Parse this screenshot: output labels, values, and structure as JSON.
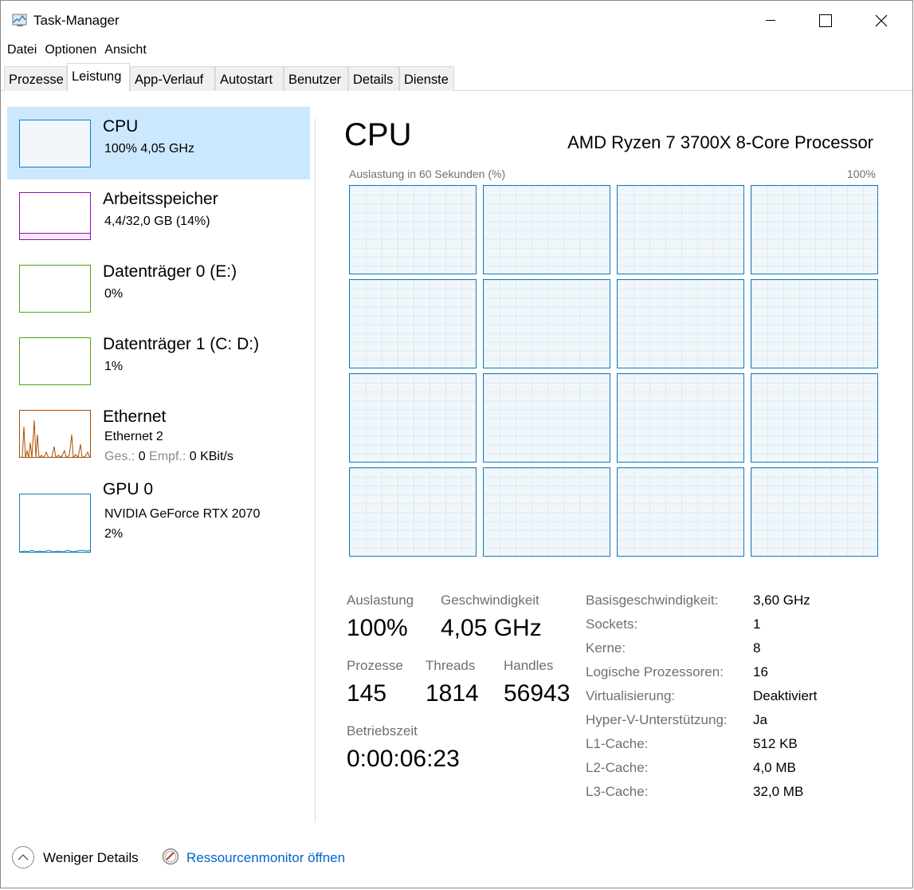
{
  "window": {
    "title": "Task-Manager"
  },
  "menu": {
    "items": [
      "Datei",
      "Optionen",
      "Ansicht"
    ]
  },
  "tabs": [
    "Prozesse",
    "Leistung",
    "App-Verlauf",
    "Autostart",
    "Benutzer",
    "Details",
    "Dienste"
  ],
  "sidebar": {
    "items": [
      {
        "title": "CPU",
        "line1": "100%  4,05 GHz",
        "color": "#117dbb"
      },
      {
        "title": "Arbeitsspeicher",
        "line1": "4,4/32,0 GB (14%)",
        "color": "#8b12ae",
        "value": 14
      },
      {
        "title": "Datenträger 0 (E:)",
        "line1": "0%",
        "color": "#4da60c",
        "value": 0
      },
      {
        "title": "Datenträger 1 (C: D:)",
        "line1": "1%",
        "color": "#4da60c",
        "value": 1
      },
      {
        "title": "Ethernet",
        "line1": "Ethernet 2",
        "line2_send_label": "Ges.:",
        "line2_send_value": "0",
        "line2_recv_label": "Empf.:",
        "line2_recv_value": "0 KBit/s",
        "color": "#a74f01"
      },
      {
        "title": "GPU 0",
        "line1": "NVIDIA GeForce RTX 2070",
        "line2": "2%",
        "color": "#117dbb",
        "value": 2
      }
    ]
  },
  "main": {
    "title": "CPU",
    "processor": "AMD Ryzen 7 3700X 8-Core Processor",
    "graph_label": "Auslastung in 60 Sekunden (%)",
    "graph_max": "100%",
    "core_count": 16,
    "stats": {
      "util_label": "Auslastung",
      "util_value": "100%",
      "speed_label": "Geschwindigkeit",
      "speed_value": "4,05 GHz",
      "proc_label": "Prozesse",
      "proc_value": "145",
      "threads_label": "Threads",
      "threads_value": "1814",
      "handles_label": "Handles",
      "handles_value": "56943",
      "uptime_label": "Betriebszeit",
      "uptime_value": "0:00:06:23"
    },
    "info": [
      {
        "label": "Basisgeschwindigkeit:",
        "value": "3,60 GHz"
      },
      {
        "label": "Sockets:",
        "value": "1"
      },
      {
        "label": "Kerne:",
        "value": "8"
      },
      {
        "label": "Logische Prozessoren:",
        "value": "16"
      },
      {
        "label": "Virtualisierung:",
        "value": "Deaktiviert"
      },
      {
        "label": "Hyper-V-Unterstützung:",
        "value": "Ja"
      },
      {
        "label": "L1-Cache:",
        "value": "512 KB"
      },
      {
        "label": "L2-Cache:",
        "value": "4,0 MB"
      },
      {
        "label": "L3-Cache:",
        "value": "32,0 MB"
      }
    ]
  },
  "footer": {
    "fewer_details": "Weniger Details",
    "resmon_link": "Ressourcenmonitor öffnen"
  }
}
